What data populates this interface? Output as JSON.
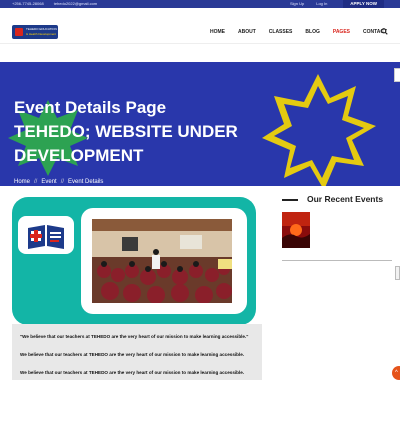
{
  "topbar": {
    "phone": "+256-7745-28068",
    "email": "tehedo2022@gmail.com",
    "sign_up": "Sign Up",
    "log_in": "Log In",
    "apply_now": "APPLY NOW"
  },
  "logo": {
    "line1": "TEHEDO EDUCATION",
    "line2": "& Health Development"
  },
  "nav": {
    "items": [
      {
        "label": "HOME"
      },
      {
        "label": "ABOUT"
      },
      {
        "label": "CLASSES"
      },
      {
        "label": "BLOG"
      },
      {
        "label": "PAGES"
      },
      {
        "label": "CONTACT"
      }
    ],
    "active_color": "#d9251d"
  },
  "hero": {
    "title_line1": "Event Details Page",
    "title_line2": "TEHEDO; WEBSITE UNDER",
    "title_line3": "DEVELOPMENT",
    "bg_color": "#2b39b0"
  },
  "breadcrumb": {
    "home": "Home",
    "event": "Event",
    "current": "Event Details"
  },
  "event": {
    "quotes": [
      "\"We believe that our teachers at TEHEDO are the very heart of our mission to make learning accessible.\"",
      "We believe that our teachers at TEHEDO are the very heart of our mission to make learning accessible.",
      "We believe that our teachers at TEHEDO are the very heart of our mission to make learning accessible."
    ]
  },
  "sidebar": {
    "recent_title": "Our Recent Events"
  },
  "colors": {
    "teal": "#13b5a6",
    "navy": "#2a3a96",
    "accent_red": "#d9251d"
  }
}
